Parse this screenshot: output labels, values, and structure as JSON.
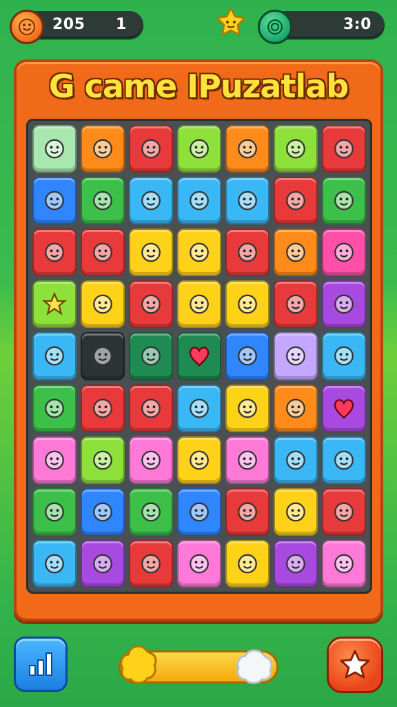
{
  "hud": {
    "left_icon": "smiley-coin-icon",
    "left_score": "205",
    "left_count": "1",
    "center_icon": "star-face-icon",
    "right_icon": "green-coin-icon",
    "right_score": "3:0"
  },
  "board": {
    "title": "G came IPuzatlab",
    "colors": {
      "frame": "#f06a1a",
      "grid_bg": "#4a4f52"
    },
    "rows": [
      [
        {
          "color": "#a8e8b0",
          "icon": "guitar-icon"
        },
        {
          "color": "#ff8c1a",
          "icon": "pencil-icon"
        },
        {
          "color": "#e83a3a",
          "icon": "rock-face-icon"
        },
        {
          "color": "#8ee03a",
          "icon": "balloon-icon"
        },
        {
          "color": "#ff8c1a",
          "icon": "book-icon"
        },
        {
          "color": "#8ee03a",
          "icon": "frame-icon"
        },
        {
          "color": "#e83a3a",
          "icon": "notebook-icon"
        }
      ],
      [
        {
          "color": "#2f86ff",
          "icon": "ghost-icon"
        },
        {
          "color": "#3cc04a",
          "icon": "document-icon"
        },
        {
          "color": "#3ab8f5",
          "icon": "triangle-face-icon"
        },
        {
          "color": "#3ab8f5",
          "icon": "paper-plane-icon"
        },
        {
          "color": "#3ab8f5",
          "icon": "brush-icon"
        },
        {
          "color": "#e83a3a",
          "icon": "giraffe-icon"
        },
        {
          "color": "#3cc04a",
          "icon": "ball-icon"
        }
      ],
      [
        {
          "color": "#e83a3a",
          "icon": "house-icon"
        },
        {
          "color": "#e83a3a",
          "icon": "marker-icon"
        },
        {
          "color": "#ffd21a",
          "icon": "face-icon"
        },
        {
          "color": "#ffd21a",
          "icon": "heart-blob-icon"
        },
        {
          "color": "#e83a3a",
          "icon": "id-card-icon"
        },
        {
          "color": "#ff8c1a",
          "icon": "coin-icon"
        },
        {
          "color": "#ff4fa8",
          "icon": "bandage-icon"
        }
      ],
      [
        {
          "color": "#8ee03a",
          "icon": "star-icon"
        },
        {
          "color": "#ffd21a",
          "icon": "bottle-icon"
        },
        {
          "color": "#e83a3a",
          "icon": "cat-face-icon"
        },
        {
          "color": "#ffd21a",
          "icon": "skull-icon"
        },
        {
          "color": "#ffd21a",
          "icon": "globe-icon"
        },
        {
          "color": "#e83a3a",
          "icon": "bear-face-icon"
        },
        {
          "color": "#a84adf",
          "icon": "gear-icon"
        }
      ],
      [
        {
          "color": "#3ab8f5",
          "icon": "cloud-icon"
        },
        {
          "color": "#2d3436",
          "icon": "flag-icon"
        },
        {
          "color": "#1f8a52",
          "icon": "drop-icon"
        },
        {
          "color": "#1f8a52",
          "icon": "heart-icon"
        },
        {
          "color": "#2f86ff",
          "icon": "camera-icon"
        },
        {
          "color": "#c4a8ff",
          "icon": "smile-icon"
        },
        {
          "color": "#3ab8f5",
          "icon": "baby-icon"
        }
      ],
      [
        {
          "color": "#3cc04a",
          "icon": "spiral-icon"
        },
        {
          "color": "#e83a3a",
          "icon": "lollipop-icon"
        },
        {
          "color": "#e83a3a",
          "icon": "pen-nib-icon"
        },
        {
          "color": "#3ab8f5",
          "icon": "robot-icon"
        },
        {
          "color": "#ffd21a",
          "icon": "map-icon"
        },
        {
          "color": "#ff8c1a",
          "icon": "orange-face-icon"
        },
        {
          "color": "#a84adf",
          "icon": "heart-icon"
        }
      ],
      [
        {
          "color": "#ff7ad8",
          "icon": "lemon-icon"
        },
        {
          "color": "#8ee03a",
          "icon": "monster-icon"
        },
        {
          "color": "#ff7ad8",
          "icon": "blob-icon"
        },
        {
          "color": "#ffd21a",
          "icon": "pumpkin-icon"
        },
        {
          "color": "#ff7ad8",
          "icon": "panda-icon"
        },
        {
          "color": "#3ab8f5",
          "icon": "brush-icon"
        },
        {
          "color": "#3ab8f5",
          "icon": "virus-icon"
        }
      ],
      [
        {
          "color": "#3cc04a",
          "icon": "bug-icon"
        },
        {
          "color": "#2f86ff",
          "icon": "alien-icon"
        },
        {
          "color": "#3cc04a",
          "icon": "leaf-icon"
        },
        {
          "color": "#2f86ff",
          "icon": "goblin-icon"
        },
        {
          "color": "#e83a3a",
          "icon": "sun-face-icon"
        },
        {
          "color": "#ffd21a",
          "icon": "lion-face-icon"
        },
        {
          "color": "#e83a3a",
          "icon": "acorn-icon"
        }
      ],
      [
        {
          "color": "#3ab8f5",
          "icon": "feather-icon"
        },
        {
          "color": "#a84adf",
          "icon": "pickaxe-icon"
        },
        {
          "color": "#e83a3a",
          "icon": "chick-icon"
        },
        {
          "color": "#ff7ad8",
          "icon": "gnome-icon"
        },
        {
          "color": "#ffd21a",
          "icon": "sun-face-icon"
        },
        {
          "color": "#a84adf",
          "icon": "hook-icon"
        },
        {
          "color": "#ff7ad8",
          "icon": "sheep-icon"
        }
      ]
    ]
  },
  "bottom": {
    "left_button_icon": "bar-chart-icon",
    "slider_icon_left": "sun-blob-icon",
    "slider_icon_right": "cloud-blob-icon",
    "slider_level": 0.78,
    "right_button_icon": "star-icon"
  }
}
